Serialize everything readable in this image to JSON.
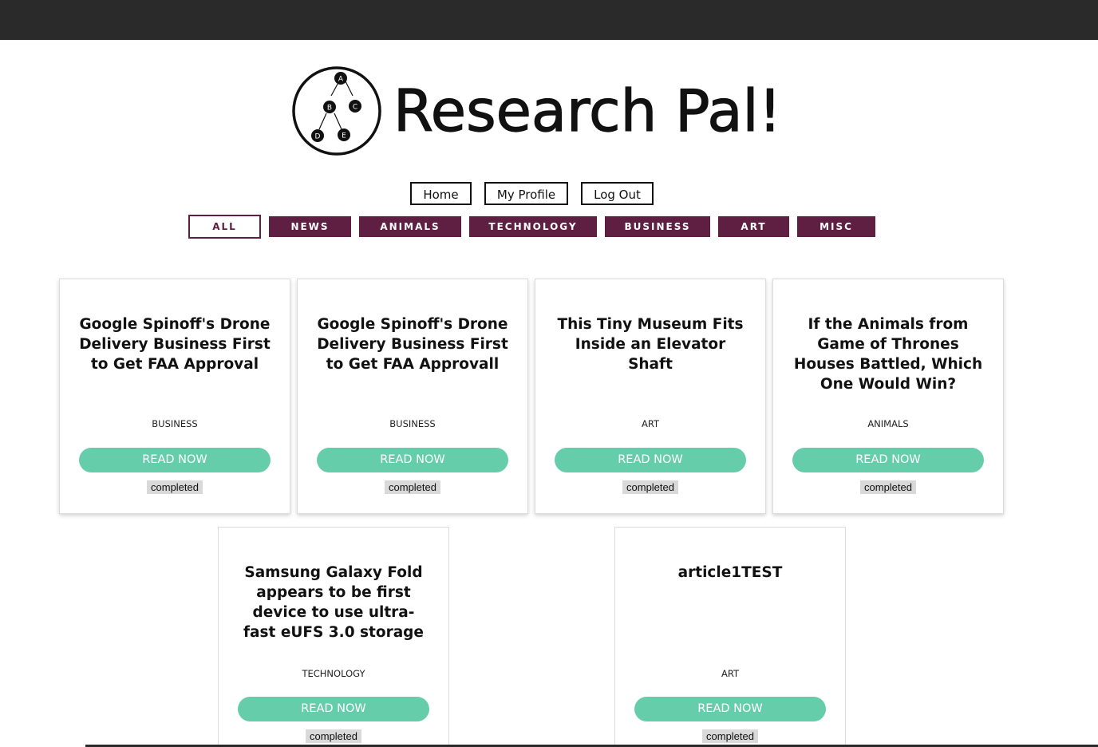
{
  "app": {
    "title": "Research Pal!"
  },
  "logo": {
    "nodes": [
      "A",
      "B",
      "C",
      "D",
      "E"
    ]
  },
  "nav": {
    "home": "Home",
    "profile": "My Profile",
    "logout": "Log Out"
  },
  "categories": {
    "active": "ALL",
    "items": [
      "ALL",
      "NEWS",
      "ANIMALS",
      "TECHNOLOGY",
      "BUSINESS",
      "ART",
      "MISC"
    ]
  },
  "cards": [
    {
      "title": "Google Spinoff's Drone Delivery Business First to Get FAA Approval",
      "category": "BUSINESS",
      "button": "READ NOW",
      "status": "completed"
    },
    {
      "title": "Google Spinoff's Drone Delivery Business First to Get FAA Approvall",
      "category": "BUSINESS",
      "button": "READ NOW",
      "status": "completed"
    },
    {
      "title": "This Tiny Museum Fits Inside an Elevator Shaft",
      "category": "ART",
      "button": "READ NOW",
      "status": "completed"
    },
    {
      "title": "If the Animals from Game of Thrones Houses Battled, Which One Would Win?",
      "category": "ANIMALS",
      "button": "READ NOW",
      "status": "completed"
    },
    {
      "title": "Samsung Galaxy Fold appears to be first device to use ultra-fast eUFS 3.0 storage",
      "category": "TECHNOLOGY",
      "button": "READ NOW",
      "status": "completed"
    },
    {
      "title": "article1TEST",
      "category": "ART",
      "button": "READ NOW",
      "status": "completed"
    }
  ],
  "colors": {
    "topbar": "#2a2a2a",
    "category_bg": "#5e1f42",
    "read_button": "#66cdaa",
    "status_bg": "#d9d9d9"
  }
}
